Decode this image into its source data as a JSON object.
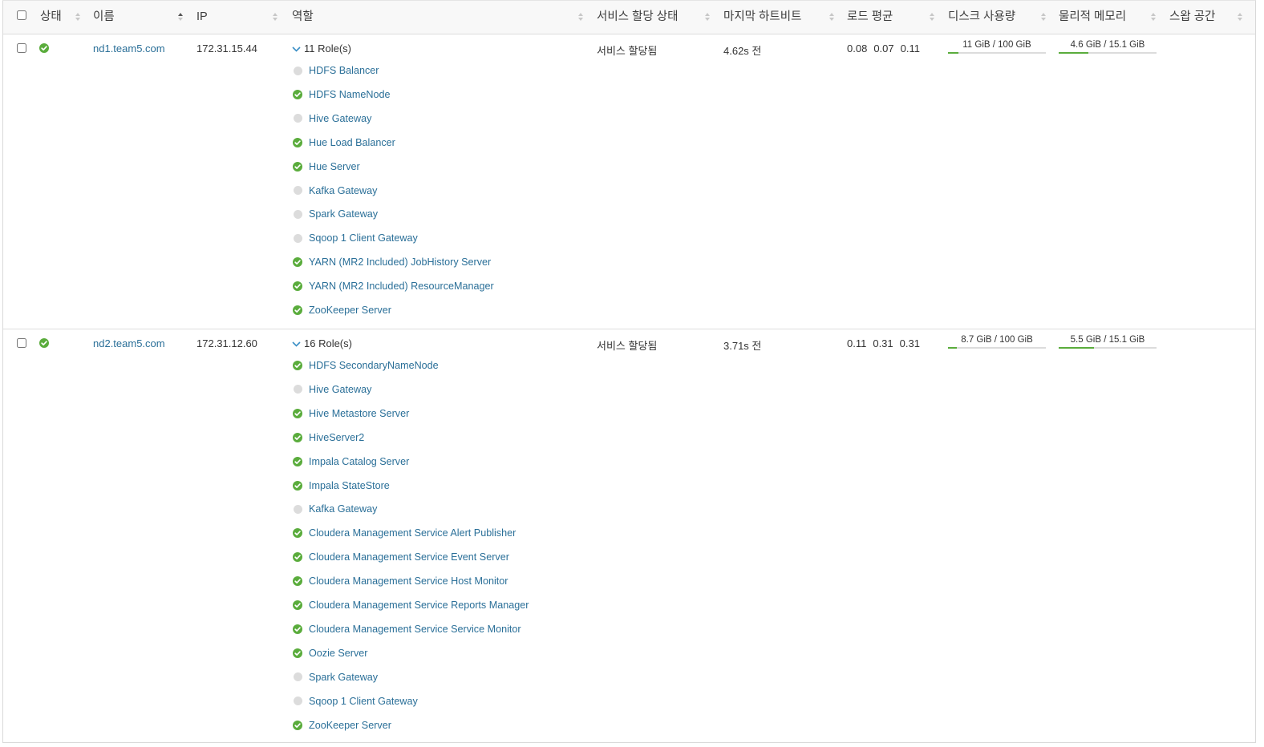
{
  "columns": {
    "status": "상태",
    "name": "이름",
    "ip": "IP",
    "roles": "역할",
    "commission_state": "서비스 할당 상태",
    "last_heartbeat": "마지막 하트비트",
    "load_average": "로드 평균",
    "disk_usage": "디스크 사용량",
    "physical_memory": "물리적 메모리",
    "swap_space": "스왑 공간"
  },
  "colors": {
    "good": "#5aac3c",
    "inactive": "#dcdcdc",
    "link": "#2a6f98"
  },
  "hosts": [
    {
      "status": "good",
      "name": "nd1.team5.com",
      "ip": "172.31.15.44",
      "roles_summary": "11 Role(s)",
      "roles": [
        {
          "name": "HDFS Balancer",
          "status": "none"
        },
        {
          "name": "HDFS NameNode",
          "status": "good"
        },
        {
          "name": "Hive Gateway",
          "status": "none"
        },
        {
          "name": "Hue Load Balancer",
          "status": "good"
        },
        {
          "name": "Hue Server",
          "status": "good"
        },
        {
          "name": "Kafka Gateway",
          "status": "none"
        },
        {
          "name": "Spark Gateway",
          "status": "none"
        },
        {
          "name": "Sqoop 1 Client Gateway",
          "status": "none"
        },
        {
          "name": "YARN (MR2 Included) JobHistory Server",
          "status": "good"
        },
        {
          "name": "YARN (MR2 Included) ResourceManager",
          "status": "good"
        },
        {
          "name": "ZooKeeper Server",
          "status": "good"
        }
      ],
      "commission_state": "서비스 할당됨",
      "last_heartbeat": "4.62s 전",
      "load_average": [
        "0.08",
        "0.07",
        "0.11"
      ],
      "disk": {
        "label": "11 GiB / 100 GiB",
        "fraction": 0.11
      },
      "memory": {
        "label": "4.6 GiB / 15.1 GiB",
        "fraction": 0.305
      },
      "swap": ""
    },
    {
      "status": "good",
      "name": "nd2.team5.com",
      "ip": "172.31.12.60",
      "roles_summary": "16 Role(s)",
      "roles": [
        {
          "name": "HDFS SecondaryNameNode",
          "status": "good"
        },
        {
          "name": "Hive Gateway",
          "status": "none"
        },
        {
          "name": "Hive Metastore Server",
          "status": "good"
        },
        {
          "name": "HiveServer2",
          "status": "good"
        },
        {
          "name": "Impala Catalog Server",
          "status": "good"
        },
        {
          "name": "Impala StateStore",
          "status": "good"
        },
        {
          "name": "Kafka Gateway",
          "status": "none"
        },
        {
          "name": "Cloudera Management Service Alert Publisher",
          "status": "good"
        },
        {
          "name": "Cloudera Management Service Event Server",
          "status": "good"
        },
        {
          "name": "Cloudera Management Service Host Monitor",
          "status": "good"
        },
        {
          "name": "Cloudera Management Service Reports Manager",
          "status": "good"
        },
        {
          "name": "Cloudera Management Service Service Monitor",
          "status": "good"
        },
        {
          "name": "Oozie Server",
          "status": "good"
        },
        {
          "name": "Spark Gateway",
          "status": "none"
        },
        {
          "name": "Sqoop 1 Client Gateway",
          "status": "none"
        },
        {
          "name": "ZooKeeper Server",
          "status": "good"
        }
      ],
      "commission_state": "서비스 할당됨",
      "last_heartbeat": "3.71s 전",
      "load_average": [
        "0.11",
        "0.31",
        "0.31"
      ],
      "disk": {
        "label": "8.7 GiB / 100 GiB",
        "fraction": 0.087
      },
      "memory": {
        "label": "5.5 GiB / 15.1 GiB",
        "fraction": 0.364
      },
      "swap": ""
    }
  ]
}
